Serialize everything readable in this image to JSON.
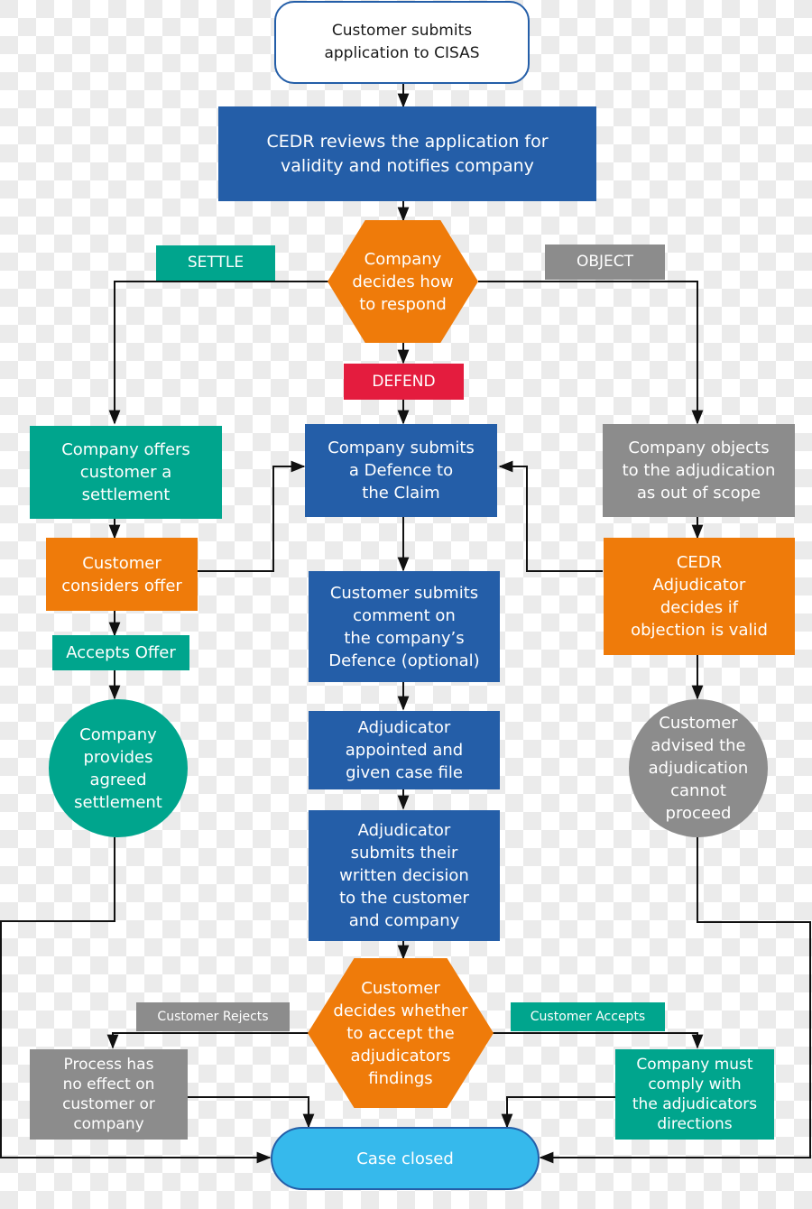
{
  "diagram": {
    "type": "flowchart",
    "nodes": {
      "start": "Customer submits\napplication to CISAS",
      "cedr_review": "CEDR reviews the application for\nvalidity and notifies company",
      "company_decides": "Company\ndecides how\nto respond",
      "settle_label": "SETTLE",
      "object_label": "OBJECT",
      "defend_label": "DEFEND",
      "company_offers": "Company offers\ncustomer a\nsettlement",
      "customer_considers": "Customer\nconsiders offer",
      "accepts_offer": "Accepts Offer",
      "company_provides": "Company\nprovides\nagreed\nsettlement",
      "company_defence": "Company submits\na Defence to\nthe Claim",
      "customer_comment": "Customer submits\ncomment on\nthe company’s\nDefence (optional)",
      "adjudicator_appointed": "Adjudicator\nappointed and\ngiven case file",
      "adjudicator_decision": "Adjudicator\nsubmits their\nwritten decision\nto the customer\nand company",
      "company_objects": "Company objects\nto the adjudication\nas out of scope",
      "cedr_adjudicator": "CEDR\nAdjudicator\ndecides if\nobjection is valid",
      "customer_advised": "Customer\nadvised the\nadjudication\ncannot\nproceed",
      "customer_decides": "Customer\ndecides whether\nto accept the\nadjudicators\nfindings",
      "customer_rejects_label": "Customer Rejects",
      "customer_accepts_label": "Customer Accepts",
      "process_no_effect": "Process has\nno effect on\ncustomer or\ncompany",
      "company_must_comply": "Company must\ncomply with\nthe adjudicators\ndirections",
      "case_closed": "Case closed"
    },
    "colors": {
      "blue": "#245ea8",
      "teal": "#00a58d",
      "orange": "#ef7b0a",
      "gray": "#8c8c8c",
      "red": "#e41c3e",
      "light_blue": "#36b9ec"
    }
  }
}
